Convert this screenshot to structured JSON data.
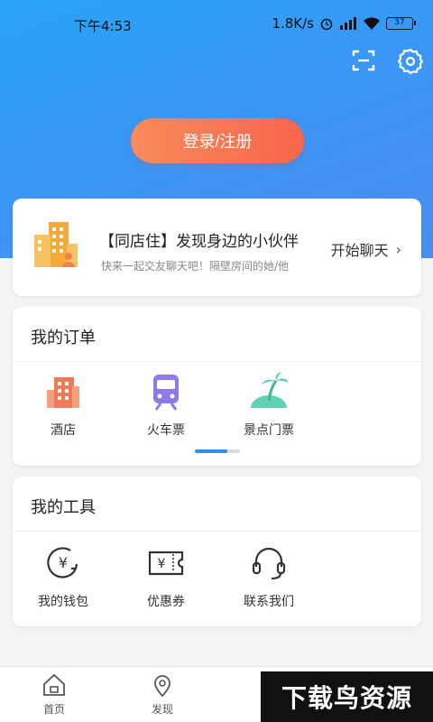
{
  "status": {
    "time": "下午4:53",
    "net_speed": "1.8K/s",
    "battery": "37"
  },
  "header": {
    "scan_icon": "scan-icon",
    "settings_icon": "gear-icon"
  },
  "login": {
    "label": "登录/注册"
  },
  "promo": {
    "title": "【同店住】发现身边的小伙伴",
    "subtitle": "快来一起交友聊天吧！隔壁房间的她/他",
    "action": "开始聊天",
    "chevron": "›"
  },
  "orders": {
    "title": "我的订单",
    "items": [
      {
        "label": "酒店",
        "icon": "hotel-icon"
      },
      {
        "label": "火车票",
        "icon": "train-icon"
      },
      {
        "label": "景点门票",
        "icon": "island-icon"
      }
    ]
  },
  "tools": {
    "title": "我的工具",
    "items": [
      {
        "label": "我的钱包",
        "icon": "wallet-icon"
      },
      {
        "label": "优惠券",
        "icon": "coupon-icon"
      },
      {
        "label": "联系我们",
        "icon": "headset-icon"
      }
    ]
  },
  "tabbar": {
    "items": [
      {
        "label": "首页",
        "icon": "home-icon"
      },
      {
        "label": "发现",
        "icon": "location-icon"
      }
    ]
  },
  "watermark": "下载鸟资源",
  "colors": {
    "hero_start": "#28a3f7",
    "hero_end": "#4a8ef2",
    "login_start": "#f98b5b",
    "login_end": "#f7664c",
    "accent": "#2f8ef0"
  }
}
